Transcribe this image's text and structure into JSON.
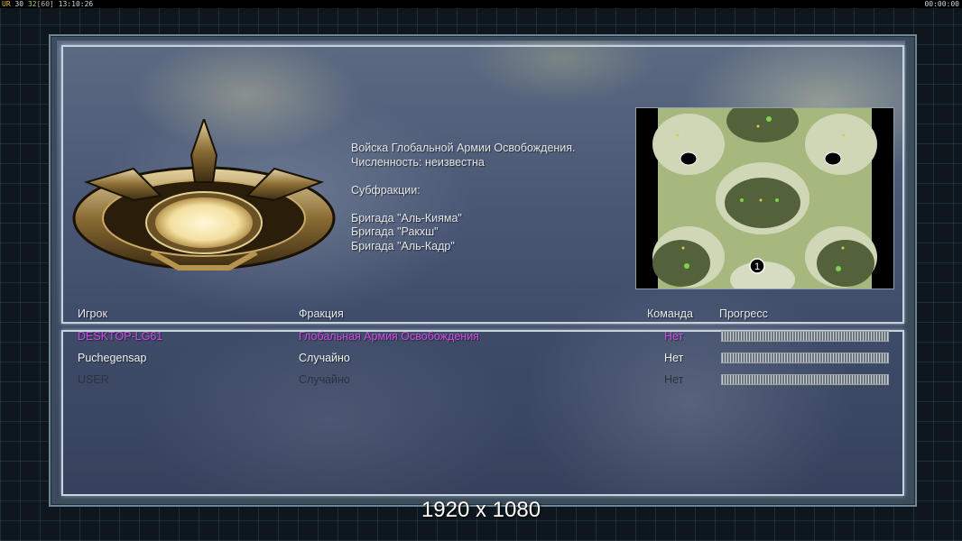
{
  "topbar": {
    "ur": "UR",
    "fps_current": "30",
    "fps_limit": "32",
    "fps_cap": "[60]",
    "clock": "13:10:26",
    "timer": "00:00:00"
  },
  "faction_info": {
    "line1": "Войска Глобальной Армии Освобождения.",
    "line2": "Численность: неизвестна",
    "line3": "Субфракции:",
    "line4": "Бригада \"Аль-Кияма\"",
    "line5": "Бригада \"Ракхш\"",
    "line6": "Бригада \"Аль-Кадр\""
  },
  "minimap": {
    "start_marker": "1"
  },
  "table": {
    "headers": {
      "player": "Игрок",
      "faction": "Фракция",
      "team": "Команда",
      "progress": "Прогресс"
    },
    "rows": [
      {
        "player": "DESKTOP-LG61",
        "faction": "Глобальная Армия Освобождения",
        "team": "Нет",
        "progress": 0
      },
      {
        "player": "Puchegensap",
        "faction": "Случайно",
        "team": "Нет",
        "progress": 0
      },
      {
        "player": "USER",
        "faction": "Случайно",
        "team": "Нет",
        "progress": 0
      }
    ]
  },
  "footer": {
    "resolution": "1920 x 1080"
  },
  "colors": {
    "local_player": "#d24ae0",
    "panel_border": "#c7d3dc"
  }
}
